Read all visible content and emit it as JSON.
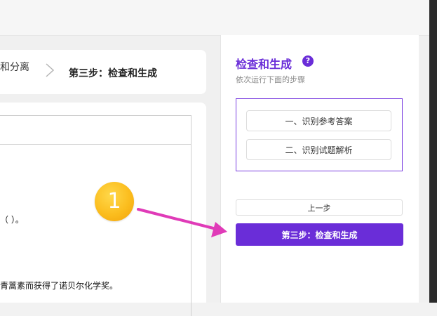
{
  "breadcrumb": {
    "previous_step_fragment": "和分离",
    "current_step": "第三步：检查和生成"
  },
  "document": {
    "line_1": "（   ）。",
    "line_2": "青蒿素而获得了诺贝尔化学奖。"
  },
  "panel": {
    "title": "检查和生成",
    "subtitle": "依次运行下面的步骤",
    "steps": [
      "一、识别参考答案",
      "二、识别试题解析"
    ],
    "prev_label": "上一步",
    "primary_label": "第三步：检查和生成"
  },
  "annotation": {
    "badge_number": "1"
  },
  "icons": {
    "help": "question-circle-icon",
    "chevron": "chevron-right-icon",
    "arrow": "annotation-arrow-icon"
  },
  "colors": {
    "accent": "#6a2dd8",
    "annotation_arrow": "#e03bb8",
    "badge": "#fbbd1e"
  }
}
